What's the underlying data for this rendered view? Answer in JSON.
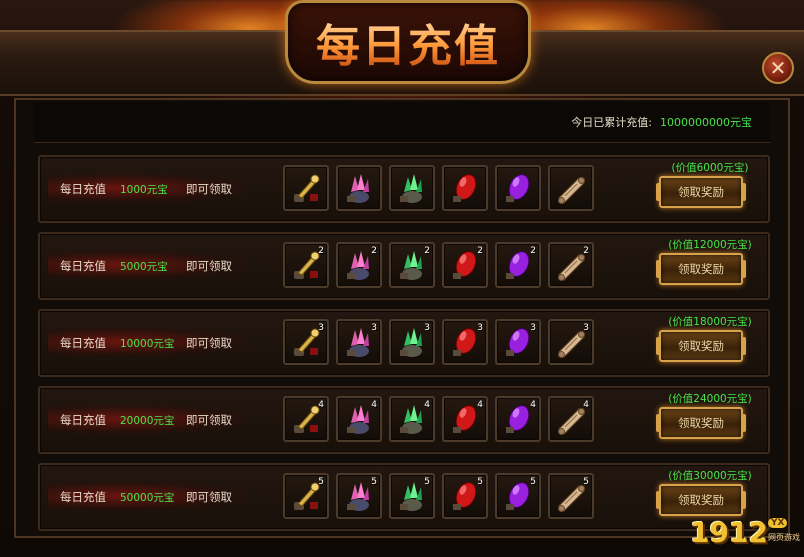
{
  "window": {
    "title": "每日充值"
  },
  "summary": {
    "label": "今日已累计充值:",
    "value": "1000000000元宝"
  },
  "item_types": [
    "gold-key-icon",
    "pink-crystal-icon",
    "green-crystal-icon",
    "red-gem-icon",
    "purple-gem-icon",
    "scroll-icon"
  ],
  "tiers": [
    {
      "label": "每日充值",
      "amount": "1000元宝",
      "suffix": "即可领取",
      "qty": "",
      "worth": "(价值6000元宝)",
      "button": "领取奖励"
    },
    {
      "label": "每日充值",
      "amount": "5000元宝",
      "suffix": "即可领取",
      "qty": "2",
      "worth": "(价值12000元宝)",
      "button": "领取奖励"
    },
    {
      "label": "每日充值",
      "amount": "10000元宝",
      "suffix": "即可领取",
      "qty": "3",
      "worth": "(价值18000元宝)",
      "button": "领取奖励"
    },
    {
      "label": "每日充值",
      "amount": "20000元宝",
      "suffix": "即可领取",
      "qty": "4",
      "worth": "(价值24000元宝)",
      "button": "领取奖励"
    },
    {
      "label": "每日充值",
      "amount": "50000元宝",
      "suffix": "即可领取",
      "qty": "5",
      "worth": "(价值30000元宝)",
      "button": "领取奖励"
    }
  ],
  "watermark": {
    "number": "1912",
    "badge": "YX",
    "sub": "网页游戏"
  },
  "colors": {
    "value_green": "#48e44a",
    "gold_border": "#d7a24a",
    "title_gradient_top": "#ffe9c0",
    "title_gradient_bottom": "#c2400a"
  }
}
